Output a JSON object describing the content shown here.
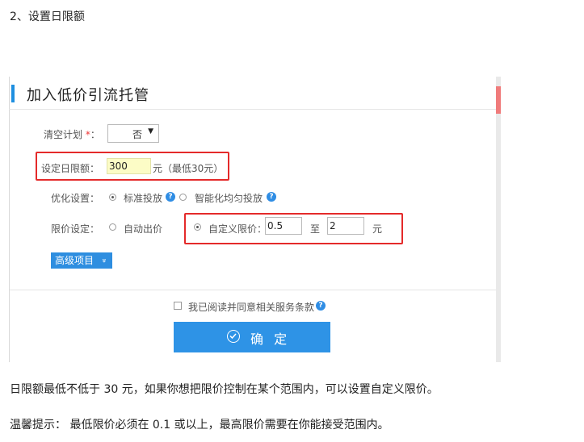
{
  "doc": {
    "heading": "2、设置日限额",
    "paragraph1": "日限额最低不低于 30 元，如果你想把限价控制在某个范围内，可以设置自定义限价。",
    "paragraph2": "温馨提示：  最低限价必须在 0.1 或以上，最高限价需要在你能接受范围内。"
  },
  "dialog": {
    "title": "加入低价引流托管",
    "clear_plan": {
      "label": "清空计划",
      "required_mark": "*",
      "colon": "：",
      "value": "否",
      "arrow": "▼"
    },
    "daily_budget": {
      "label": "设定日限额：",
      "value": "300",
      "unit_hint": "元（最低30元）"
    },
    "optimize": {
      "label": "优化设置：",
      "options": [
        {
          "label": "标准投放",
          "selected": true
        },
        {
          "label": "智能化均匀投放",
          "selected": false
        }
      ],
      "help": "?"
    },
    "price_limit": {
      "label": "限价设定：",
      "auto_label": "自动出价",
      "custom_label": "自定义限价：",
      "min": "0.5",
      "to": "至",
      "max": "2",
      "unit": "元"
    },
    "advanced_button": "高级项目",
    "advanced_chevron": "»",
    "agree_text": "我已阅读并同意相关服务条款",
    "confirm_button": "确 定"
  },
  "colors": {
    "accent_blue": "#2e8ee0",
    "highlight_red": "#e42a2a",
    "input_yellow": "#fcfcc6"
  }
}
